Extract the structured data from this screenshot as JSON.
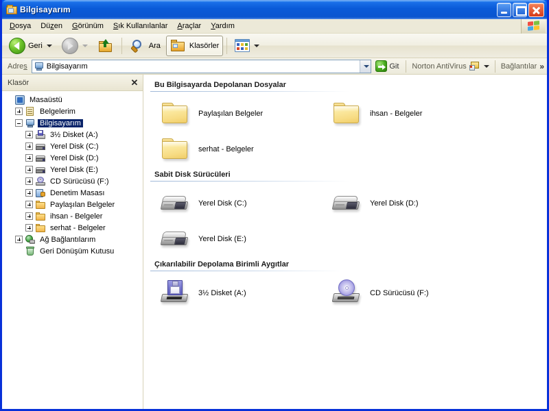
{
  "window": {
    "title": "Bilgisayarım",
    "title_icon": "folder-icon",
    "minimize_label": "_",
    "maximize_label": "□",
    "close_label": "✕"
  },
  "menubar": {
    "items": [
      {
        "label": "Dosya",
        "accel": "D"
      },
      {
        "label": "Düzen",
        "accel": "z"
      },
      {
        "label": "Görünüm",
        "accel": "G"
      },
      {
        "label": "Sık Kullanılanlar",
        "accel": "S"
      },
      {
        "label": "Araçlar",
        "accel": "A"
      },
      {
        "label": "Yardım",
        "accel": "Y"
      }
    ],
    "logo": "windows-flag-icon"
  },
  "toolbar": {
    "back_label": "Geri",
    "back_icon": "back-arrow-icon",
    "forward_icon": "forward-arrow-icon",
    "up_icon": "up-folder-icon",
    "search_label": "Ara",
    "search_icon": "search-icon",
    "folders_label": "Klasörler",
    "folders_icon": "folders-icon",
    "views_icon": "views-icon"
  },
  "addressbar": {
    "label": "Adres",
    "value": "Bilgisayarım",
    "icon": "my-computer-icon",
    "dropdown_icon": "chevron-down-icon",
    "go_label": "Git",
    "go_icon": "go-arrow-icon",
    "norton_label": "Norton AntiVirus",
    "norton_icon": "norton-antivirus-icon",
    "links_label": "Bağlantılar",
    "links_chevron": "»"
  },
  "sidebar": {
    "title": "Klasör",
    "close_label": "✕",
    "tree": [
      {
        "label": "Masaüstü",
        "icon": "desktop-icon",
        "indent": 0,
        "expander": "none",
        "selected": false
      },
      {
        "label": "Belgelerim",
        "icon": "documents-icon",
        "indent": 1,
        "expander": "plus",
        "selected": false
      },
      {
        "label": "Bilgisayarım",
        "icon": "my-computer-icon",
        "indent": 1,
        "expander": "minus",
        "selected": true
      },
      {
        "label": "3½ Disket (A:)",
        "icon": "floppy-icon",
        "indent": 2,
        "expander": "plus",
        "selected": false
      },
      {
        "label": "Yerel Disk (C:)",
        "icon": "harddisk-icon",
        "indent": 2,
        "expander": "plus",
        "selected": false
      },
      {
        "label": "Yerel Disk (D:)",
        "icon": "harddisk-icon",
        "indent": 2,
        "expander": "plus",
        "selected": false
      },
      {
        "label": "Yerel Disk (E:)",
        "icon": "harddisk-icon",
        "indent": 2,
        "expander": "plus",
        "selected": false
      },
      {
        "label": "CD Sürücüsü (F:)",
        "icon": "cd-drive-icon",
        "indent": 2,
        "expander": "plus",
        "selected": false
      },
      {
        "label": "Denetim Masası",
        "icon": "control-panel-icon",
        "indent": 2,
        "expander": "plus",
        "selected": false
      },
      {
        "label": "Paylaşılan Belgeler",
        "icon": "folder-icon",
        "indent": 2,
        "expander": "plus",
        "selected": false
      },
      {
        "label": "ihsan - Belgeler",
        "icon": "folder-icon",
        "indent": 2,
        "expander": "plus",
        "selected": false
      },
      {
        "label": "serhat - Belgeler",
        "icon": "folder-icon",
        "indent": 2,
        "expander": "plus",
        "selected": false
      },
      {
        "label": "Ağ Bağlantılarım",
        "icon": "network-icon",
        "indent": 1,
        "expander": "plus",
        "selected": false
      },
      {
        "label": "Geri Dönüşüm Kutusu",
        "icon": "recycle-bin-icon",
        "indent": 1,
        "expander": "none",
        "selected": false
      }
    ]
  },
  "content": {
    "sections": [
      {
        "heading": "Bu Bilgisayarda Depolanan Dosyalar",
        "icon_kind": "folder",
        "items": [
          {
            "label": "Paylaşılan Belgeler"
          },
          {
            "label": "ihsan - Belgeler"
          },
          {
            "label": "serhat - Belgeler"
          }
        ]
      },
      {
        "heading": "Sabit Disk Sürücüleri",
        "icon_kind": "harddisk",
        "items": [
          {
            "label": "Yerel Disk (C:)"
          },
          {
            "label": "Yerel Disk (D:)"
          },
          {
            "label": "Yerel Disk (E:)"
          }
        ]
      },
      {
        "heading": "Çıkarılabilir Depolama Birimli Aygıtlar",
        "icon_kind": "removable",
        "items": [
          {
            "label": "3½ Disket (A:)",
            "icon_kind": "floppy"
          },
          {
            "label": "CD Sürücüsü (F:)",
            "icon_kind": "cd"
          }
        ]
      }
    ]
  },
  "colors": {
    "title_blue": "#0a5ad8",
    "window_border": "#0831d9",
    "menu_face": "#ece9d8",
    "selection": "#0a246a",
    "section_rule": "#9fb8d8"
  }
}
